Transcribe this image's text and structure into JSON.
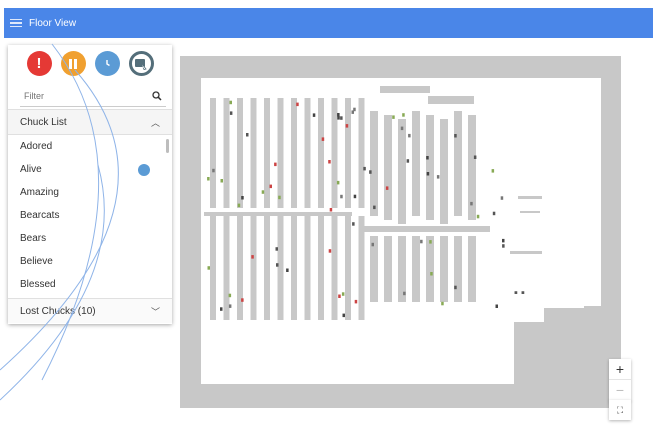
{
  "app": {
    "title": "Floor View"
  },
  "filters": [
    {
      "name": "alert",
      "icon": "exclamation-icon",
      "color": "#e53935"
    },
    {
      "name": "paused",
      "icon": "pause-icon",
      "color": "#f0a030"
    },
    {
      "name": "time",
      "icon": "clock-icon",
      "color": "#5b9bd5"
    },
    {
      "name": "device",
      "icon": "device-pointer-icon",
      "color": "#546e7a"
    }
  ],
  "search": {
    "placeholder": "Filter",
    "icon": "search-icon"
  },
  "chuck_list": {
    "title": "Chuck List",
    "items": [
      {
        "label": "Adored"
      },
      {
        "label": "Alive",
        "badge": "clock-icon"
      },
      {
        "label": "Amazing"
      },
      {
        "label": "Bearcats"
      },
      {
        "label": "Bears"
      },
      {
        "label": "Believe"
      },
      {
        "label": "Blessed"
      }
    ]
  },
  "lost_chucks": {
    "label": "Lost Chucks (10)"
  },
  "map_controls": {
    "zoom_in": "+",
    "zoom_out": "−",
    "fit": "⛶"
  },
  "colors": {
    "header": "#4a86e8",
    "floor": "#c8c8c8",
    "accent": "#5b9bd5"
  }
}
